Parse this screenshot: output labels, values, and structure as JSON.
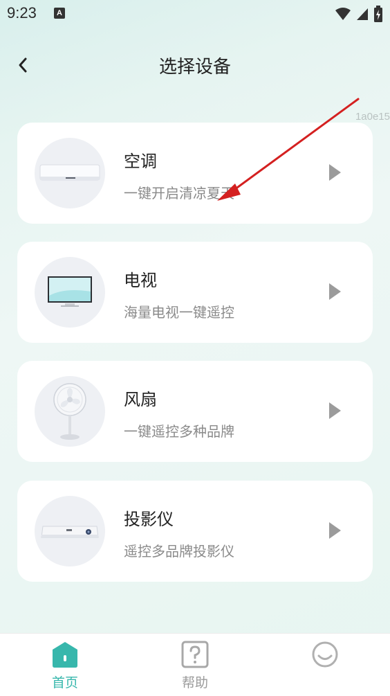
{
  "status": {
    "time": "9:23",
    "notification_badge": "A"
  },
  "header": {
    "title": "选择设备"
  },
  "watermark": "1a0e15",
  "devices": [
    {
      "name": "空调",
      "desc": "一键开启清凉夏天",
      "icon": "air-conditioner-icon"
    },
    {
      "name": "电视",
      "desc": "海量电视一键遥控",
      "icon": "tv-icon"
    },
    {
      "name": "风扇",
      "desc": "一键遥控多种品牌",
      "icon": "fan-icon"
    },
    {
      "name": "投影仪",
      "desc": "遥控多品牌投影仪",
      "icon": "projector-icon"
    }
  ],
  "tabs": [
    {
      "label": "首页",
      "icon": "home-icon",
      "active": true
    },
    {
      "label": "帮助",
      "icon": "help-icon",
      "active": false
    },
    {
      "label": "",
      "icon": "smiley-icon",
      "active": false
    }
  ],
  "colors": {
    "accent": "#37b7ac",
    "annotation_arrow": "#d42020"
  }
}
